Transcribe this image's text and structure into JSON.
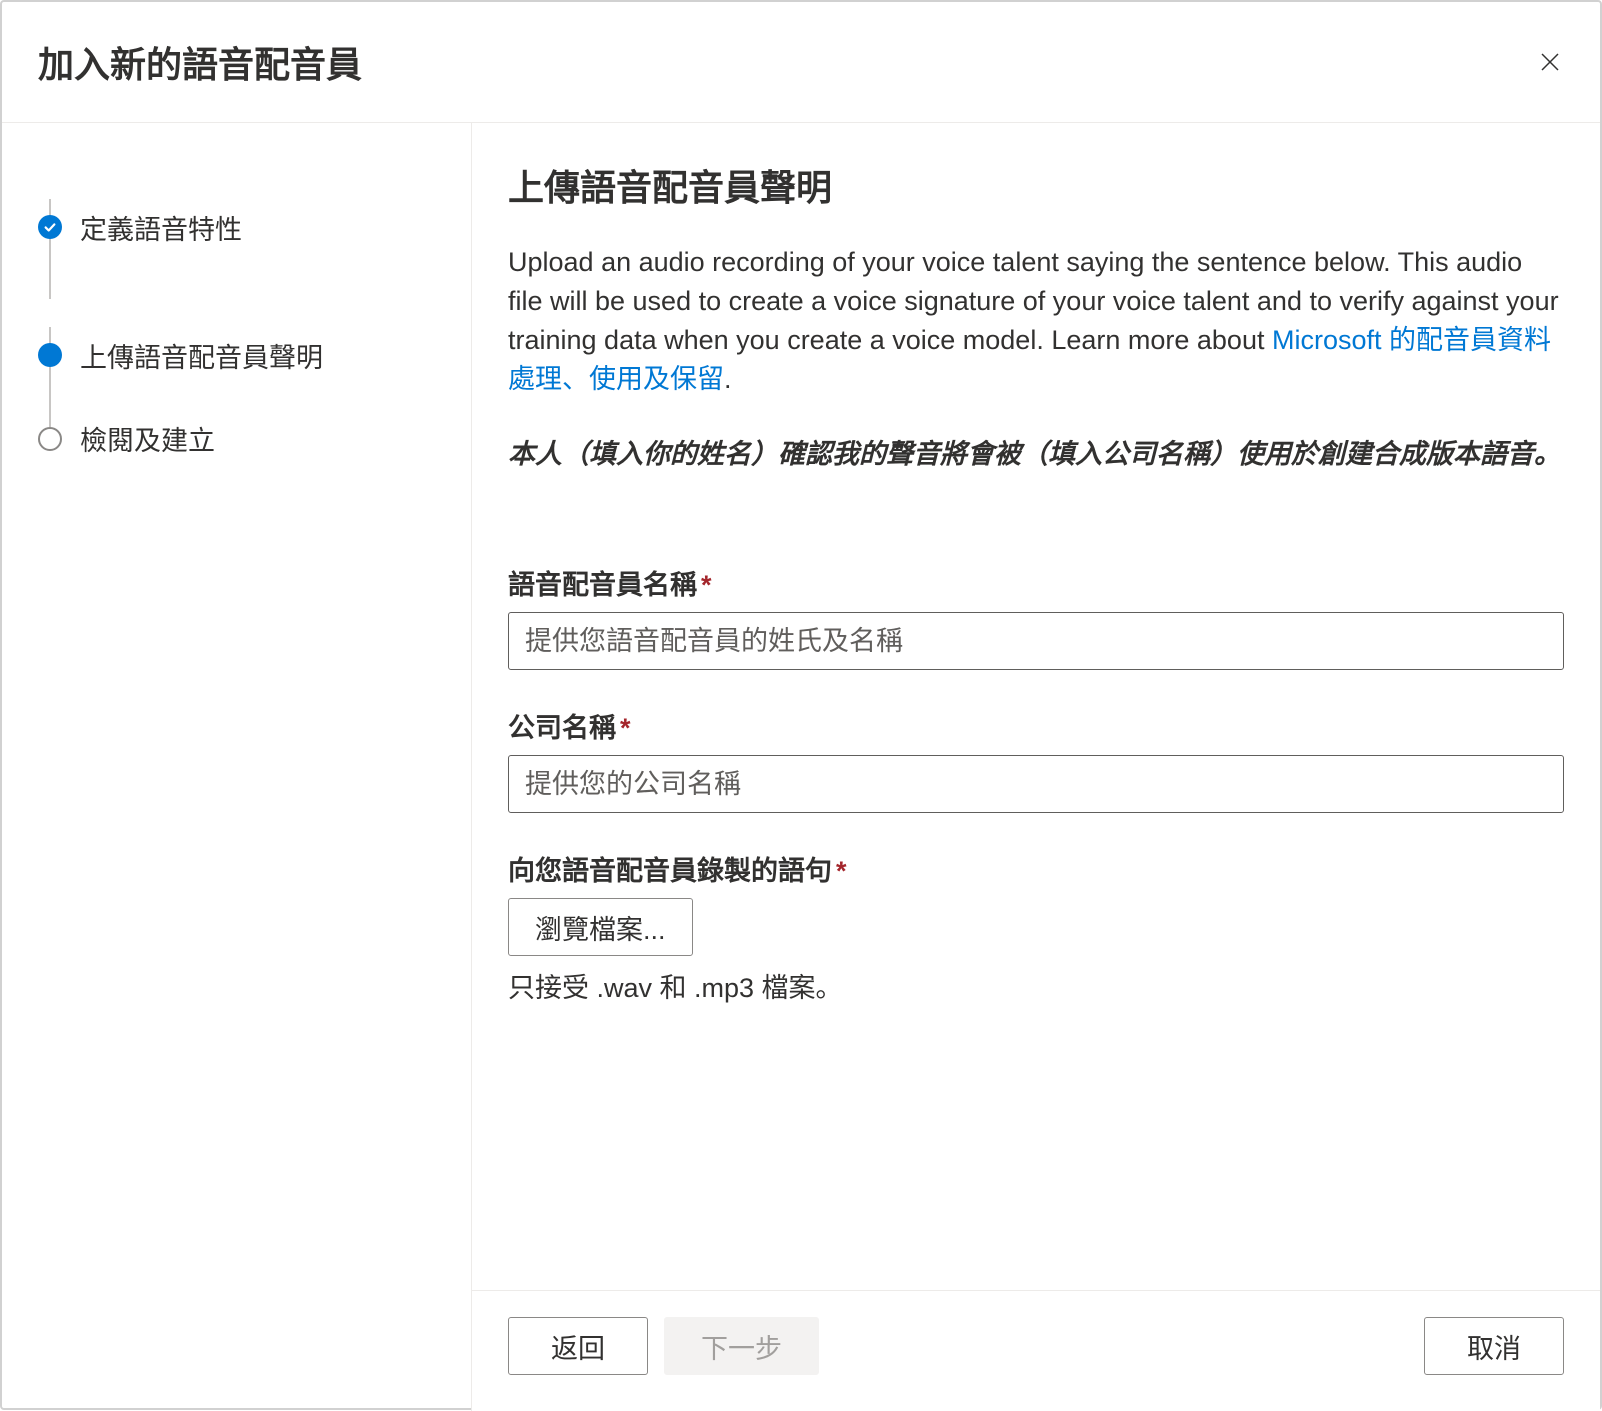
{
  "header": {
    "title": "加入新的語音配音員"
  },
  "sidebar": {
    "steps": [
      {
        "label": "定義語音特性",
        "state": "completed"
      },
      {
        "label": "上傳語音配音員聲明",
        "state": "current"
      },
      {
        "label": "檢閱及建立",
        "state": "pending"
      }
    ]
  },
  "main": {
    "title": "上傳語音配音員聲明",
    "description_prefix": "Upload an audio recording of your voice talent saying the sentence below. This audio file will be used to create a voice signature of your voice talent and to verify against your training data when you create a voice model. Learn more about ",
    "link_text": "Microsoft 的配音員資料處理、使用及保留",
    "description_suffix": ".",
    "statement": "本人（填入你的姓名）確認我的聲音將會被（填入公司名稱）使用於創建合成版本語音。",
    "fields": {
      "talent_name": {
        "label": "語音配音員名稱",
        "placeholder": "提供您語音配音員的姓氏及名稱",
        "value": ""
      },
      "company_name": {
        "label": "公司名稱",
        "placeholder": "提供您的公司名稱",
        "value": ""
      },
      "audio_file": {
        "label": "向您語音配音員錄製的語句",
        "button": "瀏覽檔案...",
        "help": "只接受 .wav 和 .mp3 檔案。"
      }
    }
  },
  "footer": {
    "back": "返回",
    "next": "下一步",
    "cancel": "取消"
  }
}
